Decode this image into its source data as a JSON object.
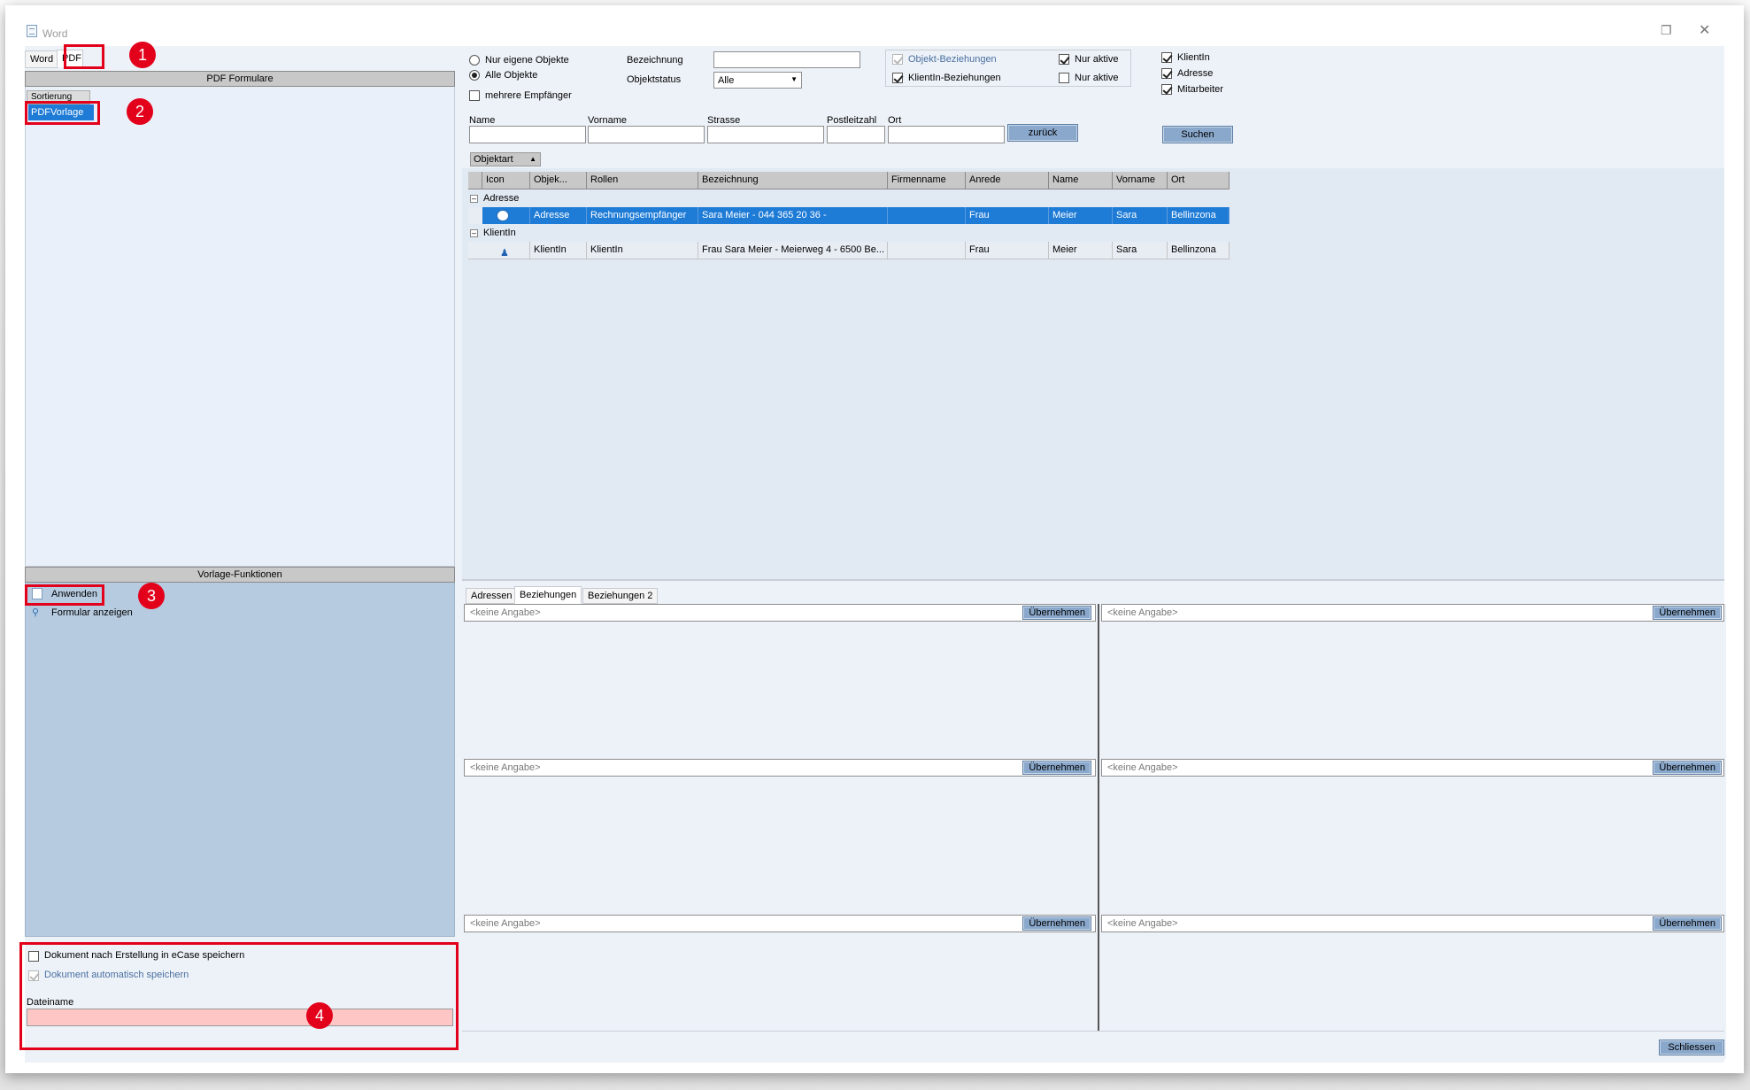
{
  "window": {
    "title": "Word"
  },
  "left": {
    "tabs": [
      "Word",
      "PDF"
    ],
    "pdf_header": "PDF Formulare",
    "sort_tab": "Sortierung",
    "selected_template": "PDFVorlage",
    "functions_header": "Vorlage-Funktionen",
    "functions": [
      "Anwenden",
      "Formular anzeigen"
    ],
    "save_in_ecase": "Dokument nach Erstellung in eCase speichern",
    "auto_save": "Dokument automatisch speichern",
    "filename_label": "Dateiname",
    "filename_value": ""
  },
  "badges": [
    "1",
    "2",
    "3",
    "4"
  ],
  "search": {
    "radio_own": "Nur eigene Objekte",
    "radio_all": "Alle Objekte",
    "multi_recipients": "mehrere Empfänger",
    "bezeichnung_label": "Bezeichnung",
    "objektstatus_label": "Objektstatus",
    "objektstatus_value": "Alle",
    "obj_rel": "Objekt-Beziehungen",
    "klient_rel": "KlientIn-Beziehungen",
    "nur_aktive_1": "Nur aktive",
    "nur_aktive_2": "Nur aktive",
    "cb_klient": "KlientIn",
    "cb_adresse": "Adresse",
    "cb_mitarbeiter": "Mitarbeiter",
    "name_label": "Name",
    "vorname_label": "Vorname",
    "strasse_label": "Strasse",
    "plz_label": "Postleitzahl",
    "ort_label": "Ort",
    "back_button": "zurück",
    "search_button": "Suchen"
  },
  "grid": {
    "group_by": "Objektart",
    "columns": [
      "Icon",
      "Objek...",
      "Rollen",
      "Bezeichnung",
      "Firmenname",
      "Anrede",
      "Name",
      "Vorname",
      "Ort"
    ],
    "groups": [
      {
        "name": "Adresse",
        "rows": [
          [
            "Adresse",
            "Rechnungsempfänger",
            "Sara Meier -  044 365 20 36 -",
            "",
            "Frau",
            "Meier",
            "Sara",
            "Bellinzona"
          ]
        ]
      },
      {
        "name": "KlientIn",
        "rows": [
          [
            "KlientIn",
            "KlientIn",
            "Frau Sara Meier -  Meierweg 4 -  6500 Be...",
            "",
            "Frau",
            "Meier",
            "Sara",
            "Bellinzona"
          ]
        ]
      }
    ]
  },
  "bottom_tabs": [
    "Adressen",
    "Beziehungen",
    "Beziehungen 2"
  ],
  "relation_panels": {
    "placeholder": "<keine Angabe>",
    "button": "Übernehmen"
  },
  "close_button": "Schliessen"
}
